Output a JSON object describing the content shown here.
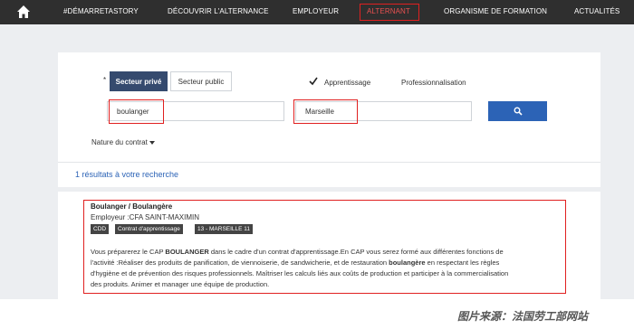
{
  "nav": {
    "items": [
      "#DÉMARRETASTORY",
      "DÉCOUVRIR L'ALTERNANCE",
      "EMPLOYEUR",
      "ALTERNANT",
      "ORGANISME DE FORMATION",
      "ACTUALITÉS"
    ],
    "highlighted": "ALTERNANT"
  },
  "form": {
    "required_mark": "*",
    "sector_tabs": [
      "Secteur privé",
      "Secteur public"
    ],
    "contract_options": [
      "Apprentissage",
      "Professionnalisation"
    ],
    "job_value": "boulanger",
    "location_value": "Marseille",
    "filter_label": "Nature du contrat"
  },
  "results": {
    "summary": "1 résultats à votre recherche"
  },
  "card": {
    "title": "Boulanger / Boulangère",
    "employer": "Employeur :CFA SAINT-MAXIMIN",
    "tags": [
      "CDD",
      "Contrat d'apprentissage",
      "13 - MARSEILLE 11"
    ],
    "desc_lines": [
      [
        "Vous préparerez le CAP ",
        "BOULANGER",
        " dans le cadre d'un contrat d'apprentissage.En CAP vous serez formé aux différentes fonctions de"
      ],
      [
        "l'activité :Réaliser des produits de panification, de viennoiserie, de sandwicherie, et de restauration ",
        "boulangère",
        " en respectant les règles"
      ],
      [
        "d'hygiène et de prévention des risques professionnels. Maîtriser les calculs liés aux coûts de production et participer à la commercialisation",
        "",
        ""
      ],
      [
        "des produits. Animer et manager une équipe de production.",
        "",
        ""
      ]
    ]
  },
  "credit": "图片来源：法国劳工部网站",
  "colors": {
    "nav_bg": "#2f2f2f",
    "accent_dark": "#354a6e",
    "button_blue": "#2c63b6",
    "highlight_red": "#e02020"
  }
}
